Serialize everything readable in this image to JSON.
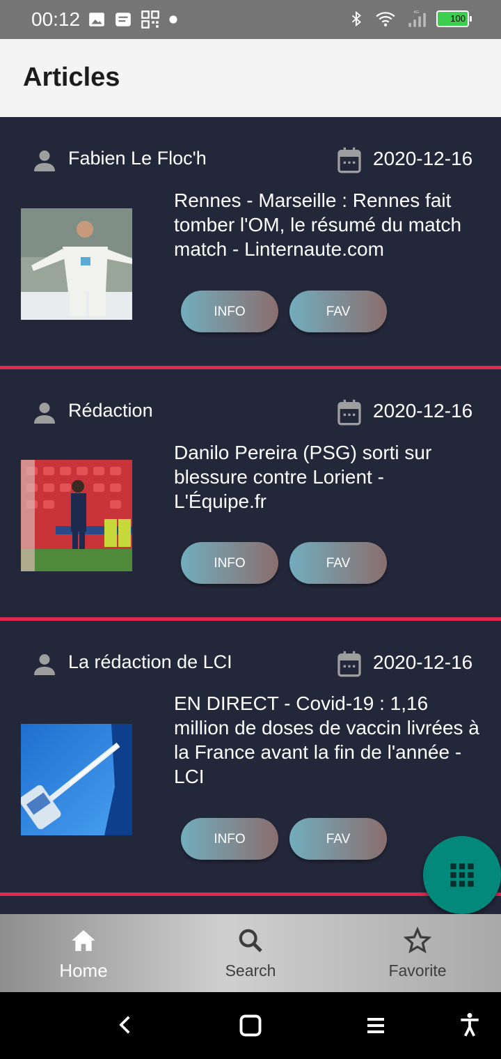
{
  "status_bar": {
    "time": "00:12",
    "battery": "100",
    "network": "4G"
  },
  "app_bar": {
    "title": "Articles"
  },
  "articles": [
    {
      "author": "Fabien Le Floc'h",
      "date": "2020-12-16",
      "title": "Rennes - Marseille : Rennes fait tomber l'OM, le résumé du match match - Linternaute.com",
      "info_label": "INFO",
      "fav_label": "FAV"
    },
    {
      "author": "Rédaction",
      "date": "2020-12-16",
      "title": "Danilo Pereira (PSG) sorti sur blessure contre Lorient - L'Équipe.fr",
      "info_label": "INFO",
      "fav_label": "FAV"
    },
    {
      "author": "La rédaction de LCI",
      "date": "2020-12-16",
      "title": "EN DIRECT - Covid-19 : 1,16 million de doses de vaccin livrées à la France avant la fin de l'année - LCI",
      "info_label": "INFO",
      "fav_label": "FAV"
    }
  ],
  "bottom_nav": {
    "items": [
      {
        "label": "Home",
        "icon": "home-icon",
        "active": true
      },
      {
        "label": "Search",
        "icon": "search-icon",
        "active": false
      },
      {
        "label": "Favorite",
        "icon": "star-icon",
        "active": false
      }
    ]
  },
  "fab": {
    "icon": "grid-icon"
  },
  "colors": {
    "background": "#23273a",
    "divider": "#e0294f",
    "fab": "#03897b",
    "app_bar": "#f4f4f4"
  }
}
